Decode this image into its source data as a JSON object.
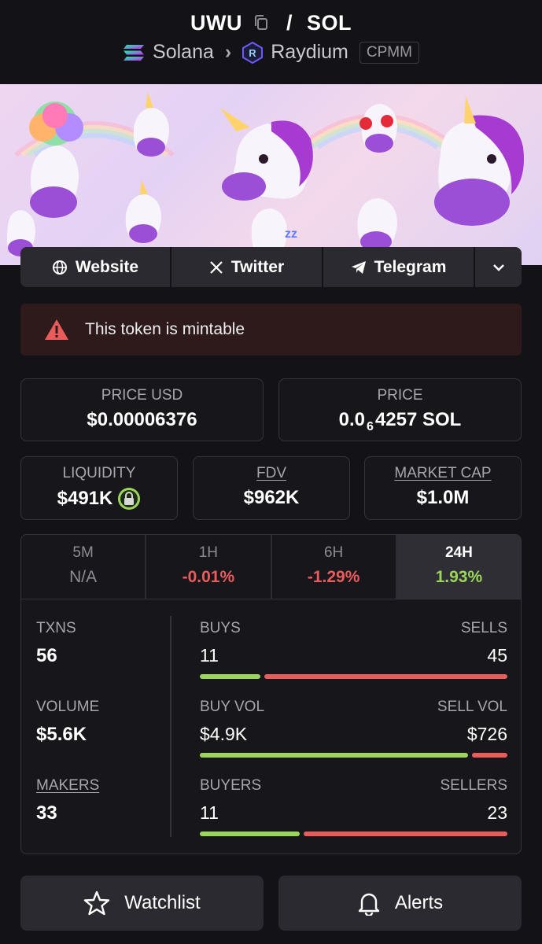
{
  "header": {
    "base_symbol": "UWU",
    "separator": "/",
    "quote_symbol": "SOL",
    "chain": "Solana",
    "dex": "Raydium",
    "pool_type": "CPMM"
  },
  "links": {
    "website": "Website",
    "twitter": "Twitter",
    "telegram": "Telegram"
  },
  "alert": {
    "text": "This token is mintable"
  },
  "metrics": {
    "price_usd_label": "PRICE USD",
    "price_usd": "$0.00006376",
    "price_label": "PRICE",
    "price_prefix": "0.0",
    "price_zeros": "6",
    "price_suffix": "4257 SOL",
    "liquidity_label": "LIQUIDITY",
    "liquidity": "$491K",
    "fdv_label": "FDV",
    "fdv": "$962K",
    "mcap_label": "MARKET CAP",
    "mcap": "$1.0M"
  },
  "timeframes": [
    {
      "label": "5M",
      "value": "N/A"
    },
    {
      "label": "1H",
      "value": "-0.01%"
    },
    {
      "label": "6H",
      "value": "-1.29%"
    },
    {
      "label": "24H",
      "value": "1.93%"
    }
  ],
  "stats": {
    "txns_label": "TXNS",
    "txns": "56",
    "volume_label": "VOLUME",
    "volume": "$5.6K",
    "makers_label": "MAKERS",
    "makers": "33",
    "buys_label": "BUYS",
    "buys": "11",
    "sells_label": "SELLS",
    "sells": "45",
    "buy_vol_label": "BUY VOL",
    "buy_vol": "$4.9K",
    "sell_vol_label": "SELL VOL",
    "sell_vol": "$726",
    "buyers_label": "BUYERS",
    "buyers": "11",
    "sellers_label": "SELLERS",
    "sellers": "23",
    "buys_share": 0.196,
    "buy_vol_share": 0.871,
    "buyers_share": 0.324
  },
  "actions": {
    "watchlist": "Watchlist",
    "alerts": "Alerts"
  },
  "colors": {
    "positive": "#9bd55a",
    "negative": "#ea5b5b",
    "background": "#131317"
  }
}
